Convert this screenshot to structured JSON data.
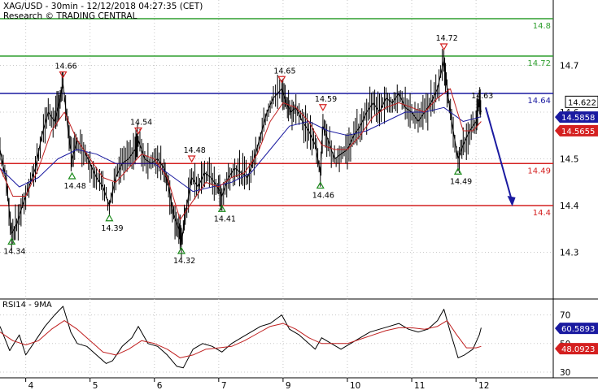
{
  "header": {
    "line1": "XAG/USD - 30min - 12/12/2018 04:27:35 (CET)",
    "line2": "Research © TRADING CENTRAL"
  },
  "chart_data": [
    {
      "type": "line",
      "panel": "price",
      "instrument": "XAG/USD",
      "timeframe": "30min",
      "ylim": [
        14.2,
        14.84
      ],
      "yticks": [
        "14.3",
        "14.4",
        "14.5",
        "14.6",
        "14.7"
      ],
      "xticks": [
        {
          "label": "4",
          "x": 4
        },
        {
          "label": "5",
          "x": 5
        },
        {
          "label": "6",
          "x": 6
        },
        {
          "label": "7",
          "x": 7
        },
        {
          "label": "9",
          "x": 8
        },
        {
          "label": "10",
          "x": 9
        },
        {
          "label": "11",
          "x": 10
        },
        {
          "label": "12",
          "x": 11
        }
      ],
      "xlim": [
        3.6,
        12.2
      ],
      "grid": true,
      "levels": [
        {
          "value": 14.8,
          "label": "14.8",
          "color": "#2e9e2e"
        },
        {
          "value": 14.72,
          "label": "14.72",
          "color": "#2e9e2e"
        },
        {
          "value": 14.64,
          "label": "14.64",
          "color": "#1a1aa0"
        },
        {
          "value": 14.49,
          "label": "14.49",
          "color": "#d42020"
        },
        {
          "value": 14.4,
          "label": "14.4",
          "color": "#d42020"
        }
      ],
      "last_price": {
        "value": 14.622,
        "label": "14.622"
      },
      "ma_tags": [
        {
          "value": 14.5858,
          "label": "14.5858",
          "color": "#1a1aa0"
        },
        {
          "value": 14.5655,
          "label": "14.5655",
          "color": "#d42020"
        }
      ],
      "swing_points": [
        {
          "x": 3.78,
          "y": 14.34,
          "label": "14.34",
          "kind": "low"
        },
        {
          "x": 4.58,
          "y": 14.66,
          "label": "14.66",
          "kind": "high"
        },
        {
          "x": 4.72,
          "y": 14.48,
          "label": "14.48",
          "kind": "low"
        },
        {
          "x": 5.3,
          "y": 14.39,
          "label": "14.39",
          "kind": "low"
        },
        {
          "x": 5.75,
          "y": 14.54,
          "label": "14.54",
          "kind": "high"
        },
        {
          "x": 6.42,
          "y": 14.32,
          "label": "14.32",
          "kind": "low"
        },
        {
          "x": 6.58,
          "y": 14.48,
          "label": "14.48",
          "kind": "high"
        },
        {
          "x": 7.05,
          "y": 14.41,
          "label": "14.41",
          "kind": "low"
        },
        {
          "x": 7.98,
          "y": 14.65,
          "label": "14.65",
          "kind": "high"
        },
        {
          "x": 8.58,
          "y": 14.46,
          "label": "14.46",
          "kind": "low"
        },
        {
          "x": 8.62,
          "y": 14.59,
          "label": "14.59",
          "kind": "high"
        },
        {
          "x": 10.5,
          "y": 14.72,
          "label": "14.72",
          "kind": "high"
        },
        {
          "x": 10.72,
          "y": 14.49,
          "label": "14.49",
          "kind": "low"
        }
      ],
      "label_only": [
        {
          "x": 11.05,
          "y": 14.63,
          "label": "14.63"
        }
      ],
      "price_path": [
        [
          3.6,
          14.52
        ],
        [
          3.7,
          14.45
        ],
        [
          3.78,
          14.34
        ],
        [
          3.86,
          14.36
        ],
        [
          3.95,
          14.4
        ],
        [
          4.05,
          14.44
        ],
        [
          4.15,
          14.48
        ],
        [
          4.25,
          14.55
        ],
        [
          4.35,
          14.6
        ],
        [
          4.45,
          14.58
        ],
        [
          4.52,
          14.62
        ],
        [
          4.58,
          14.66
        ],
        [
          4.66,
          14.56
        ],
        [
          4.72,
          14.5
        ],
        [
          4.8,
          14.54
        ],
        [
          4.9,
          14.52
        ],
        [
          5.0,
          14.49
        ],
        [
          5.1,
          14.46
        ],
        [
          5.2,
          14.44
        ],
        [
          5.3,
          14.4
        ],
        [
          5.4,
          14.46
        ],
        [
          5.5,
          14.49
        ],
        [
          5.6,
          14.5
        ],
        [
          5.7,
          14.52
        ],
        [
          5.75,
          14.54
        ],
        [
          5.85,
          14.5
        ],
        [
          5.95,
          14.49
        ],
        [
          6.05,
          14.5
        ],
        [
          6.15,
          14.48
        ],
        [
          6.22,
          14.44
        ],
        [
          6.3,
          14.38
        ],
        [
          6.38,
          14.35
        ],
        [
          6.42,
          14.32
        ],
        [
          6.48,
          14.38
        ],
        [
          6.58,
          14.46
        ],
        [
          6.68,
          14.44
        ],
        [
          6.78,
          14.47
        ],
        [
          6.88,
          14.46
        ],
        [
          6.98,
          14.44
        ],
        [
          7.05,
          14.42
        ],
        [
          7.15,
          14.46
        ],
        [
          7.25,
          14.48
        ],
        [
          7.35,
          14.47
        ],
        [
          7.45,
          14.46
        ],
        [
          7.55,
          14.5
        ],
        [
          7.65,
          14.55
        ],
        [
          7.75,
          14.6
        ],
        [
          7.85,
          14.63
        ],
        [
          7.98,
          14.65
        ],
        [
          8.05,
          14.62
        ],
        [
          8.12,
          14.6
        ],
        [
          8.2,
          14.61
        ],
        [
          8.3,
          14.58
        ],
        [
          8.4,
          14.56
        ],
        [
          8.5,
          14.53
        ],
        [
          8.58,
          14.47
        ],
        [
          8.62,
          14.57
        ],
        [
          8.7,
          14.54
        ],
        [
          8.8,
          14.5
        ],
        [
          8.9,
          14.51
        ],
        [
          9.0,
          14.52
        ],
        [
          9.1,
          14.55
        ],
        [
          9.2,
          14.57
        ],
        [
          9.3,
          14.6
        ],
        [
          9.4,
          14.62
        ],
        [
          9.5,
          14.6
        ],
        [
          9.6,
          14.63
        ],
        [
          9.7,
          14.62
        ],
        [
          9.8,
          14.64
        ],
        [
          9.9,
          14.61
        ],
        [
          10.0,
          14.6
        ],
        [
          10.1,
          14.58
        ],
        [
          10.2,
          14.6
        ],
        [
          10.3,
          14.62
        ],
        [
          10.4,
          14.65
        ],
        [
          10.5,
          14.71
        ],
        [
          10.55,
          14.65
        ],
        [
          10.62,
          14.58
        ],
        [
          10.72,
          14.5
        ],
        [
          10.8,
          14.53
        ],
        [
          10.9,
          14.56
        ],
        [
          11.0,
          14.58
        ],
        [
          11.05,
          14.62
        ],
        [
          11.08,
          14.6
        ]
      ],
      "ma_red_path": [
        [
          3.6,
          14.48
        ],
        [
          3.8,
          14.42
        ],
        [
          4.0,
          14.42
        ],
        [
          4.2,
          14.48
        ],
        [
          4.4,
          14.56
        ],
        [
          4.6,
          14.6
        ],
        [
          4.8,
          14.54
        ],
        [
          5.0,
          14.5
        ],
        [
          5.2,
          14.46
        ],
        [
          5.4,
          14.45
        ],
        [
          5.6,
          14.48
        ],
        [
          5.8,
          14.51
        ],
        [
          6.0,
          14.5
        ],
        [
          6.2,
          14.46
        ],
        [
          6.4,
          14.37
        ],
        [
          6.6,
          14.41
        ],
        [
          6.8,
          14.45
        ],
        [
          7.0,
          14.44
        ],
        [
          7.2,
          14.46
        ],
        [
          7.4,
          14.47
        ],
        [
          7.6,
          14.51
        ],
        [
          7.8,
          14.58
        ],
        [
          8.0,
          14.62
        ],
        [
          8.2,
          14.61
        ],
        [
          8.4,
          14.58
        ],
        [
          8.6,
          14.53
        ],
        [
          8.8,
          14.52
        ],
        [
          9.0,
          14.52
        ],
        [
          9.2,
          14.55
        ],
        [
          9.4,
          14.59
        ],
        [
          9.6,
          14.61
        ],
        [
          9.8,
          14.62
        ],
        [
          10.0,
          14.61
        ],
        [
          10.2,
          14.6
        ],
        [
          10.4,
          14.63
        ],
        [
          10.6,
          14.65
        ],
        [
          10.8,
          14.56
        ],
        [
          10.95,
          14.56
        ],
        [
          11.08,
          14.58
        ]
      ],
      "ma_blue_path": [
        [
          3.6,
          14.48
        ],
        [
          3.9,
          14.44
        ],
        [
          4.2,
          14.46
        ],
        [
          4.5,
          14.5
        ],
        [
          4.8,
          14.52
        ],
        [
          5.1,
          14.51
        ],
        [
          5.4,
          14.49
        ],
        [
          5.7,
          14.49
        ],
        [
          6.0,
          14.49
        ],
        [
          6.3,
          14.46
        ],
        [
          6.6,
          14.43
        ],
        [
          6.9,
          14.44
        ],
        [
          7.2,
          14.45
        ],
        [
          7.5,
          14.47
        ],
        [
          7.8,
          14.52
        ],
        [
          8.1,
          14.57
        ],
        [
          8.4,
          14.58
        ],
        [
          8.7,
          14.56
        ],
        [
          9.0,
          14.55
        ],
        [
          9.3,
          14.56
        ],
        [
          9.6,
          14.58
        ],
        [
          9.9,
          14.6
        ],
        [
          10.2,
          14.6
        ],
        [
          10.5,
          14.61
        ],
        [
          10.8,
          14.58
        ],
        [
          11.08,
          14.59
        ]
      ],
      "forecast_arrow": {
        "from": [
          11.15,
          14.61
        ],
        "to": [
          11.55,
          14.4
        ]
      }
    },
    {
      "type": "line",
      "panel": "indicator",
      "title": "RSI14 - 9MA",
      "ylim": [
        26,
        80
      ],
      "yticks": [
        "30",
        "50",
        "70"
      ],
      "tags": [
        {
          "value": 60.5893,
          "label": "60.5893",
          "color": "#1a1aa0"
        },
        {
          "value": 48.0923,
          "label": "48.0923",
          "color": "#d42020"
        }
      ],
      "rsi_path": [
        [
          3.6,
          62
        ],
        [
          3.75,
          45
        ],
        [
          3.9,
          56
        ],
        [
          4.0,
          42
        ],
        [
          4.15,
          52
        ],
        [
          4.3,
          62
        ],
        [
          4.45,
          70
        ],
        [
          4.58,
          76
        ],
        [
          4.7,
          58
        ],
        [
          4.8,
          50
        ],
        [
          4.95,
          48
        ],
        [
          5.1,
          42
        ],
        [
          5.25,
          36
        ],
        [
          5.35,
          38
        ],
        [
          5.5,
          48
        ],
        [
          5.65,
          54
        ],
        [
          5.75,
          62
        ],
        [
          5.9,
          50
        ],
        [
          6.05,
          48
        ],
        [
          6.2,
          42
        ],
        [
          6.35,
          34
        ],
        [
          6.45,
          33
        ],
        [
          6.6,
          46
        ],
        [
          6.75,
          50
        ],
        [
          6.9,
          48
        ],
        [
          7.05,
          44
        ],
        [
          7.2,
          50
        ],
        [
          7.35,
          54
        ],
        [
          7.5,
          58
        ],
        [
          7.65,
          62
        ],
        [
          7.8,
          64
        ],
        [
          7.98,
          70
        ],
        [
          8.1,
          60
        ],
        [
          8.25,
          56
        ],
        [
          8.4,
          50
        ],
        [
          8.5,
          46
        ],
        [
          8.6,
          54
        ],
        [
          8.75,
          50
        ],
        [
          8.9,
          46
        ],
        [
          9.05,
          50
        ],
        [
          9.2,
          54
        ],
        [
          9.35,
          58
        ],
        [
          9.5,
          60
        ],
        [
          9.65,
          62
        ],
        [
          9.8,
          64
        ],
        [
          9.95,
          60
        ],
        [
          10.1,
          58
        ],
        [
          10.25,
          60
        ],
        [
          10.4,
          66
        ],
        [
          10.5,
          74
        ],
        [
          10.6,
          58
        ],
        [
          10.72,
          40
        ],
        [
          10.82,
          42
        ],
        [
          10.95,
          46
        ],
        [
          11.05,
          56
        ],
        [
          11.08,
          61
        ]
      ],
      "ma_path": [
        [
          3.6,
          58
        ],
        [
          3.8,
          52
        ],
        [
          4.0,
          49
        ],
        [
          4.2,
          52
        ],
        [
          4.4,
          60
        ],
        [
          4.6,
          66
        ],
        [
          4.8,
          60
        ],
        [
          5.0,
          52
        ],
        [
          5.2,
          44
        ],
        [
          5.4,
          42
        ],
        [
          5.6,
          46
        ],
        [
          5.8,
          52
        ],
        [
          6.0,
          50
        ],
        [
          6.2,
          46
        ],
        [
          6.4,
          40
        ],
        [
          6.6,
          42
        ],
        [
          6.8,
          46
        ],
        [
          7.0,
          47
        ],
        [
          7.2,
          48
        ],
        [
          7.4,
          52
        ],
        [
          7.6,
          57
        ],
        [
          7.8,
          62
        ],
        [
          8.0,
          64
        ],
        [
          8.2,
          60
        ],
        [
          8.4,
          54
        ],
        [
          8.6,
          50
        ],
        [
          8.8,
          50
        ],
        [
          9.0,
          50
        ],
        [
          9.2,
          53
        ],
        [
          9.4,
          56
        ],
        [
          9.6,
          59
        ],
        [
          9.8,
          61
        ],
        [
          10.0,
          61
        ],
        [
          10.2,
          60
        ],
        [
          10.4,
          62
        ],
        [
          10.55,
          66
        ],
        [
          10.7,
          56
        ],
        [
          10.85,
          47
        ],
        [
          11.0,
          47
        ],
        [
          11.08,
          48
        ]
      ]
    }
  ]
}
